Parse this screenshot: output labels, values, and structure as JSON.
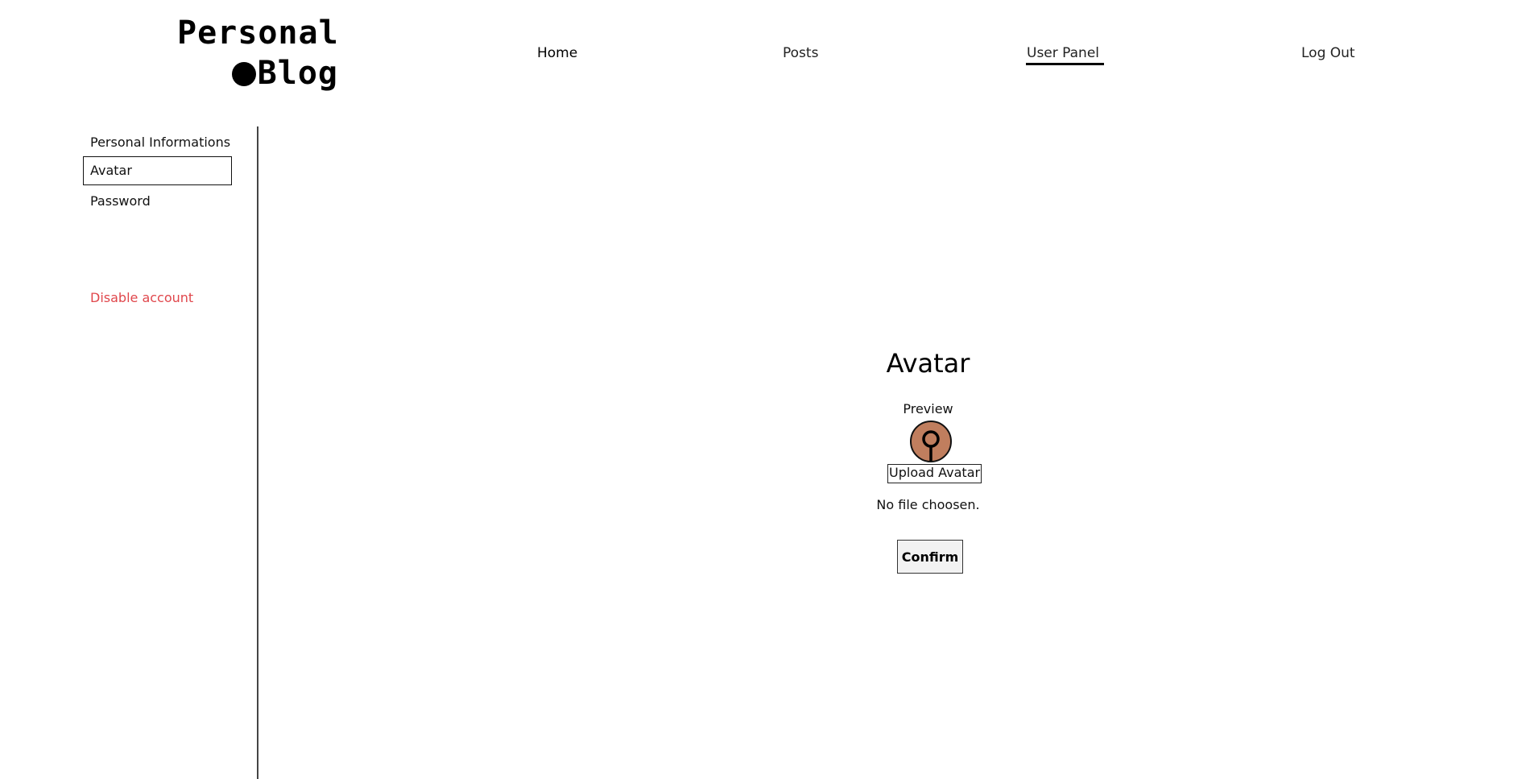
{
  "logo": {
    "line1": "Personal",
    "line2": "Blog"
  },
  "nav": {
    "items": [
      {
        "label": "Home"
      },
      {
        "label": "Posts"
      },
      {
        "label": "User Panel",
        "active": true
      },
      {
        "label": "Log Out"
      }
    ]
  },
  "sidebar": {
    "items": [
      {
        "label": "Personal Informations"
      },
      {
        "label": "Avatar",
        "selected": true
      },
      {
        "label": "Password"
      }
    ],
    "disable_label": "Disable account",
    "disable_color": "#e0474c"
  },
  "main": {
    "title": "Avatar",
    "preview_label": "Preview",
    "avatar_color": "#c07e5e",
    "upload_label": "Upload Avatar",
    "file_status": "No file choosen.",
    "confirm_label": "Confirm"
  }
}
